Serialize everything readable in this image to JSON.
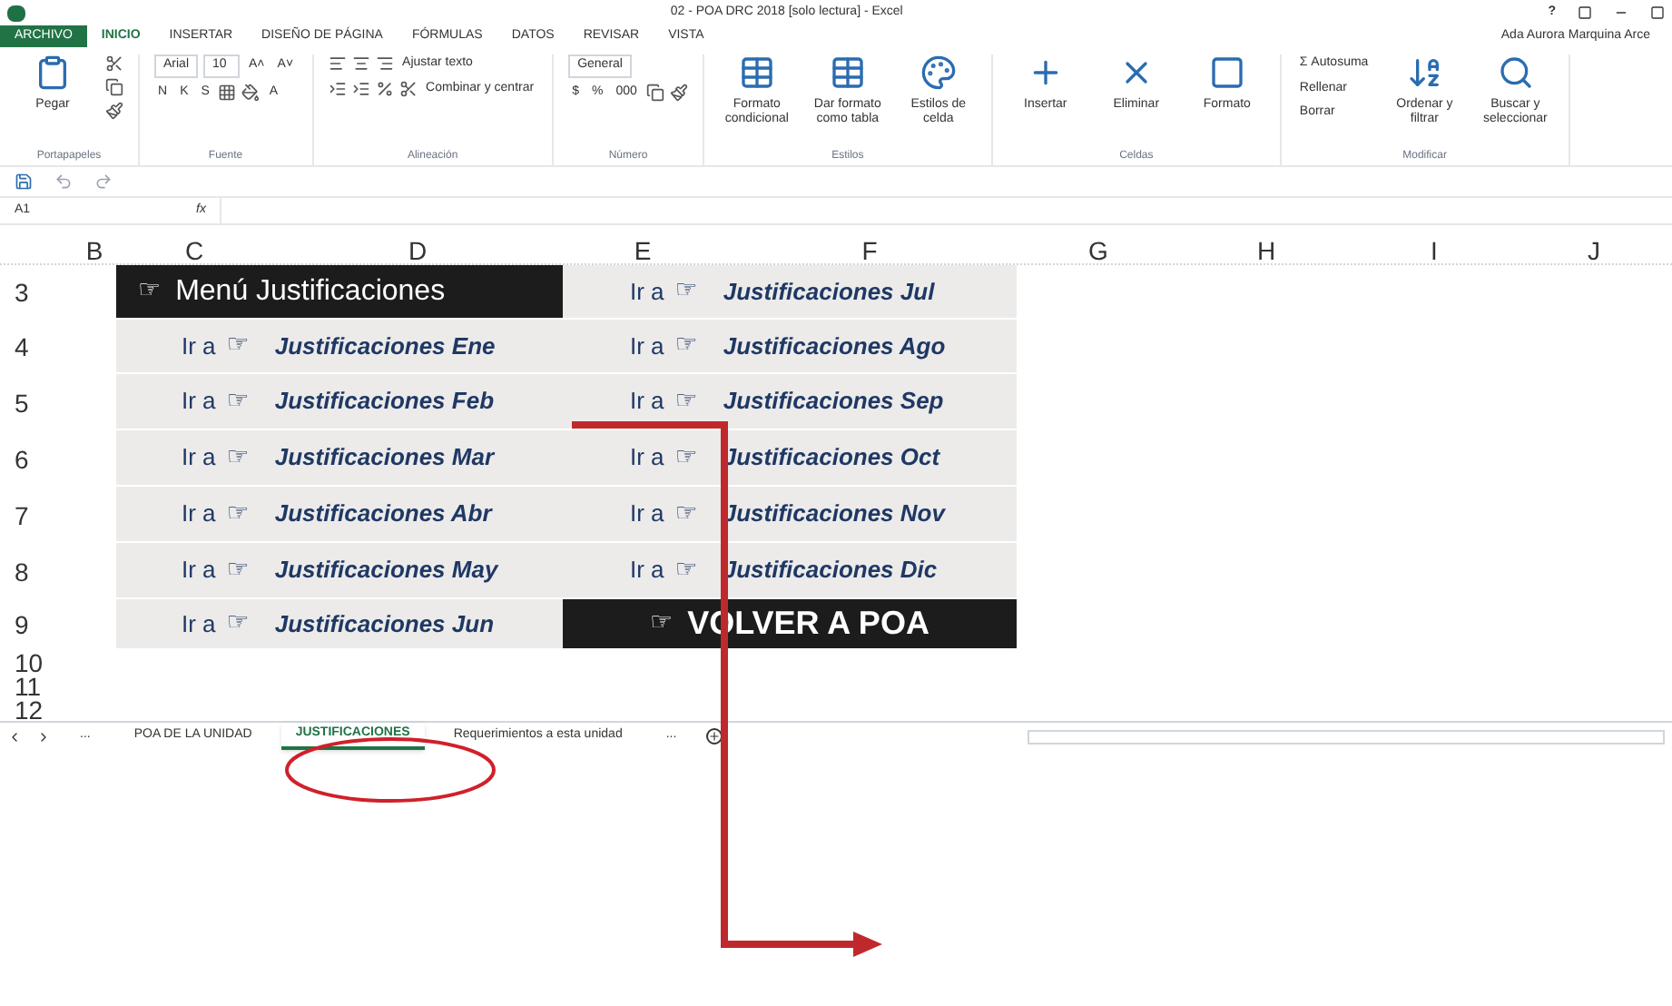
{
  "window": {
    "title": "02 - POA DRC 2018 [solo lectura] - Excel",
    "user": "Ada Aurora Marquina Arce",
    "help": "?"
  },
  "ribbon_tabs": [
    {
      "label": "ARCHIVO",
      "kind": "file",
      "selected": false
    },
    {
      "label": "INICIO",
      "kind": "tab",
      "selected": true
    },
    {
      "label": "INSERTAR",
      "kind": "tab",
      "selected": false
    },
    {
      "label": "DISEÑO DE PÁGINA",
      "kind": "tab",
      "selected": false
    },
    {
      "label": "FÓRMULAS",
      "kind": "tab",
      "selected": false
    },
    {
      "label": "DATOS",
      "kind": "tab",
      "selected": false
    },
    {
      "label": "REVISAR",
      "kind": "tab",
      "selected": false
    },
    {
      "label": "VISTA",
      "kind": "tab",
      "selected": false
    }
  ],
  "ribbon_groups": [
    {
      "label": "Portapapeles",
      "items": [
        {
          "kind": "large",
          "label": "Pegar"
        },
        {
          "kind": "stack",
          "lines": [
            {
              "items": [
                {
                  "kind": "icon"
                }
              ]
            },
            {
              "items": [
                {
                  "kind": "icon"
                }
              ]
            },
            {
              "items": [
                {
                  "kind": "icon"
                }
              ]
            }
          ]
        }
      ]
    },
    {
      "label": "Fuente",
      "items": [
        {
          "kind": "stack",
          "lines": [
            {
              "items": [
                {
                  "kind": "field",
                  "value": "Arial"
                },
                {
                  "kind": "field",
                  "value": "10"
                },
                {
                  "kind": "button",
                  "label": "A˄"
                },
                {
                  "kind": "button",
                  "label": "A˅"
                }
              ]
            },
            {
              "items": [
                {
                  "kind": "button",
                  "label": "N"
                },
                {
                  "kind": "button",
                  "label": "K"
                },
                {
                  "kind": "button",
                  "label": "S"
                },
                {
                  "kind": "icon"
                },
                {
                  "kind": "icon"
                },
                {
                  "kind": "button",
                  "label": "A"
                }
              ]
            }
          ]
        }
      ]
    },
    {
      "label": "Alineación",
      "items": [
        {
          "kind": "stack",
          "lines": [
            {
              "items": [
                {
                  "kind": "icon"
                },
                {
                  "kind": "icon"
                },
                {
                  "kind": "icon"
                },
                {
                  "kind": "button",
                  "label": "Ajustar texto"
                }
              ]
            },
            {
              "items": [
                {
                  "kind": "icon"
                },
                {
                  "kind": "icon"
                },
                {
                  "kind": "icon"
                },
                {
                  "kind": "icon"
                },
                {
                  "kind": "button",
                  "label": "Combinar y centrar"
                }
              ]
            }
          ]
        }
      ]
    },
    {
      "label": "Número",
      "items": [
        {
          "kind": "stack",
          "lines": [
            {
              "items": [
                {
                  "kind": "field",
                  "value": "General"
                }
              ]
            },
            {
              "items": [
                {
                  "kind": "button",
                  "label": "$"
                },
                {
                  "kind": "button",
                  "label": "%"
                },
                {
                  "kind": "button",
                  "label": "000"
                },
                {
                  "kind": "icon"
                },
                {
                  "kind": "icon"
                }
              ]
            }
          ]
        }
      ]
    },
    {
      "label": "Estilos",
      "items": [
        {
          "kind": "large",
          "label": "Formato condicional"
        },
        {
          "kind": "large",
          "label": "Dar formato como tabla"
        },
        {
          "kind": "large",
          "label": "Estilos de celda"
        }
      ]
    },
    {
      "label": "Celdas",
      "items": [
        {
          "kind": "large",
          "label": "Insertar"
        },
        {
          "kind": "large",
          "label": "Eliminar"
        },
        {
          "kind": "large",
          "label": "Formato"
        }
      ]
    },
    {
      "label": "Modificar",
      "items": [
        {
          "kind": "stack",
          "lines": [
            {
              "items": [
                {
                  "kind": "button",
                  "label": "Σ Autosuma"
                }
              ]
            },
            {
              "items": [
                {
                  "kind": "button",
                  "label": "Rellenar"
                }
              ]
            },
            {
              "items": [
                {
                  "kind": "button",
                  "label": "Borrar"
                }
              ]
            }
          ]
        },
        {
          "kind": "large",
          "label": "Ordenar y filtrar"
        },
        {
          "kind": "large",
          "label": "Buscar y seleccionar"
        }
      ]
    }
  ],
  "formula_bar": {
    "name_box": "A1",
    "fx": "fx"
  },
  "columns": [
    "B",
    "C",
    "D",
    "E",
    "F",
    "G",
    "H",
    "I",
    "J"
  ],
  "rows": [
    {
      "number": "3",
      "cells": [
        {
          "kind": "header",
          "icon": "☞",
          "text": "Menú Justificaciones"
        },
        {
          "kind": "link",
          "prefix": "Ir a",
          "icon": "☞",
          "text": "Justificaciones Jul"
        }
      ]
    },
    {
      "number": "4",
      "cells": [
        {
          "kind": "link",
          "prefix": "Ir a",
          "icon": "☞",
          "text": "Justificaciones Ene"
        },
        {
          "kind": "link",
          "prefix": "Ir a",
          "icon": "☞",
          "text": "Justificaciones Ago"
        }
      ]
    },
    {
      "number": "5",
      "cells": [
        {
          "kind": "link",
          "prefix": "Ir a",
          "icon": "☞",
          "text": "Justificaciones Feb"
        },
        {
          "kind": "link",
          "prefix": "Ir a",
          "icon": "☞",
          "text": "Justificaciones Sep"
        }
      ]
    },
    {
      "number": "6",
      "cells": [
        {
          "kind": "link",
          "prefix": "Ir a",
          "icon": "☞",
          "text": "Justificaciones Mar"
        },
        {
          "kind": "link",
          "prefix": "Ir a",
          "icon": "☞",
          "text": "Justificaciones Oct"
        }
      ]
    },
    {
      "number": "7",
      "cells": [
        {
          "kind": "link",
          "prefix": "Ir a",
          "icon": "☞",
          "text": "Justificaciones Abr"
        },
        {
          "kind": "link",
          "prefix": "Ir a",
          "icon": "☞",
          "text": "Justificaciones Nov"
        }
      ]
    },
    {
      "number": "8",
      "cells": [
        {
          "kind": "link",
          "prefix": "Ir a",
          "icon": "☞",
          "text": "Justificaciones May"
        },
        {
          "kind": "link",
          "prefix": "Ir a",
          "icon": "☞",
          "text": "Justificaciones Dic"
        }
      ]
    },
    {
      "number": "9",
      "cells": [
        {
          "kind": "link",
          "prefix": "Ir a",
          "icon": "☞",
          "text": "Justificaciones Jun"
        },
        {
          "kind": "header",
          "icon": "☞",
          "text": "VOLVER A POA"
        }
      ]
    },
    {
      "number": "10",
      "cells": []
    },
    {
      "number": "11",
      "cells": []
    },
    {
      "number": "12",
      "cells": []
    }
  ],
  "sheet_tabs": [
    {
      "label": "...",
      "selected": false
    },
    {
      "label": "POA DE LA UNIDAD",
      "selected": false
    },
    {
      "label": "JUSTIFICACIONES",
      "selected": true
    },
    {
      "label": "Requerimientos a esta unidad",
      "selected": false
    },
    {
      "label": "...",
      "selected": false
    }
  ]
}
